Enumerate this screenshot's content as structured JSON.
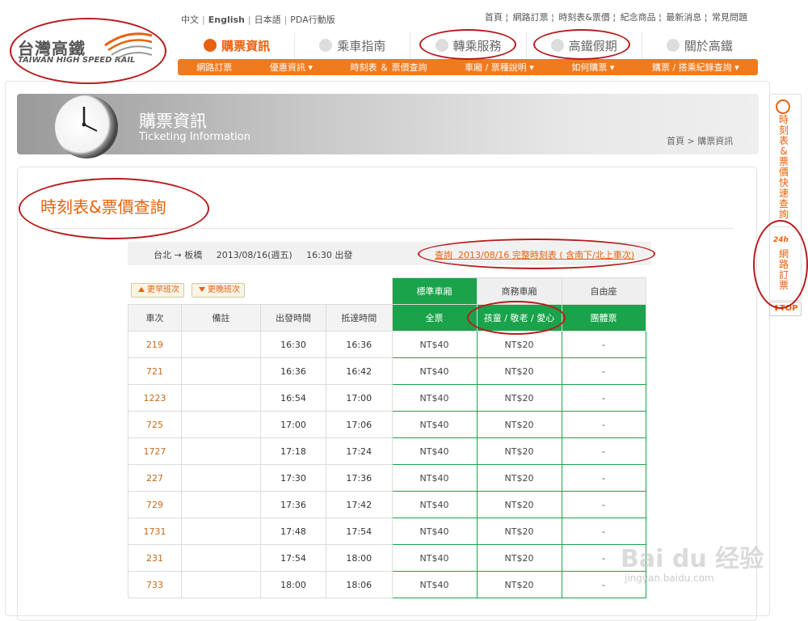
{
  "brand": {
    "name_zh": "台灣高鐵",
    "name_en": "TAIWAN HIGH SPEED RAIL",
    "accent_color": "#e8610f"
  },
  "lang_links": [
    "中文",
    "English",
    "日本語",
    "PDA行動版"
  ],
  "top_links": [
    "首頁",
    "網路訂票",
    "時刻表&票價",
    "紀念商品",
    "最新消息",
    "常見問題"
  ],
  "main_nav": [
    {
      "label": "購票資訊",
      "active": true,
      "icon": "ticket-icon"
    },
    {
      "label": "乘車指南",
      "active": false,
      "icon": "guide-icon"
    },
    {
      "label": "轉乘服務",
      "active": false,
      "icon": "transfer-icon"
    },
    {
      "label": "高鐵假期",
      "active": false,
      "icon": "vacation-icon"
    },
    {
      "label": "關於高鐵",
      "active": false,
      "icon": "info-icon"
    }
  ],
  "sub_nav": [
    "網路訂票",
    "優惠資訊 ▾",
    "時刻表 ＆ 票價查詢",
    "車廂 / 票種說明 ▾",
    "如何購票 ▾",
    "購票 / 搭乘紀錄查詢 ▾"
  ],
  "banner": {
    "title": "購票資訊",
    "subtitle": "Ticketing Information",
    "breadcrumb": "首頁 >  購票資訊"
  },
  "page_heading": "時刻表&票價查詢",
  "query": {
    "info": "台北 → 板橋     2013/08/16(週五)     16:30 出發",
    "full_link": "查詢  2013/08/16 完整時刻表 ( 含南下/北上車次)"
  },
  "buttons": {
    "earlier": "更早班次",
    "later": "更晚班次"
  },
  "car_types": {
    "standard": "標準車廂",
    "business": "商務車廂",
    "free": "自由座"
  },
  "columns": [
    "車次",
    "備註",
    "出發時間",
    "抵達時間",
    "全票",
    "孩童 / 敬老 / 愛心",
    "團體票"
  ],
  "rows": [
    {
      "train": "219",
      "note": "",
      "dep": "16:30",
      "arr": "16:36",
      "full": "NT$40",
      "concession": "NT$20",
      "group": "-"
    },
    {
      "train": "721",
      "note": "",
      "dep": "16:36",
      "arr": "16:42",
      "full": "NT$40",
      "concession": "NT$20",
      "group": "-"
    },
    {
      "train": "1223",
      "note": "",
      "dep": "16:54",
      "arr": "17:00",
      "full": "NT$40",
      "concession": "NT$20",
      "group": "-"
    },
    {
      "train": "725",
      "note": "",
      "dep": "17:00",
      "arr": "17:06",
      "full": "NT$40",
      "concession": "NT$20",
      "group": "-"
    },
    {
      "train": "1727",
      "note": "",
      "dep": "17:18",
      "arr": "17:24",
      "full": "NT$40",
      "concession": "NT$20",
      "group": "-"
    },
    {
      "train": "227",
      "note": "",
      "dep": "17:30",
      "arr": "17:36",
      "full": "NT$40",
      "concession": "NT$20",
      "group": "-"
    },
    {
      "train": "729",
      "note": "",
      "dep": "17:36",
      "arr": "17:42",
      "full": "NT$40",
      "concession": "NT$20",
      "group": "-"
    },
    {
      "train": "1731",
      "note": "",
      "dep": "17:48",
      "arr": "17:54",
      "full": "NT$40",
      "concession": "NT$20",
      "group": "-"
    },
    {
      "train": "231",
      "note": "",
      "dep": "17:54",
      "arr": "18:00",
      "full": "NT$40",
      "concession": "NT$20",
      "group": "-"
    },
    {
      "train": "733",
      "note": "",
      "dep": "18:00",
      "arr": "18:06",
      "full": "NT$40",
      "concession": "NT$20",
      "group": "-"
    }
  ],
  "sidebar": {
    "quick_timetable": "時刻表&票價快速查詢",
    "badge_24h": "24h",
    "online_booking": "網路訂票",
    "top": "TOP"
  },
  "watermark": {
    "main": "Bai du 经验",
    "url": "jingyan.baidu.com"
  }
}
